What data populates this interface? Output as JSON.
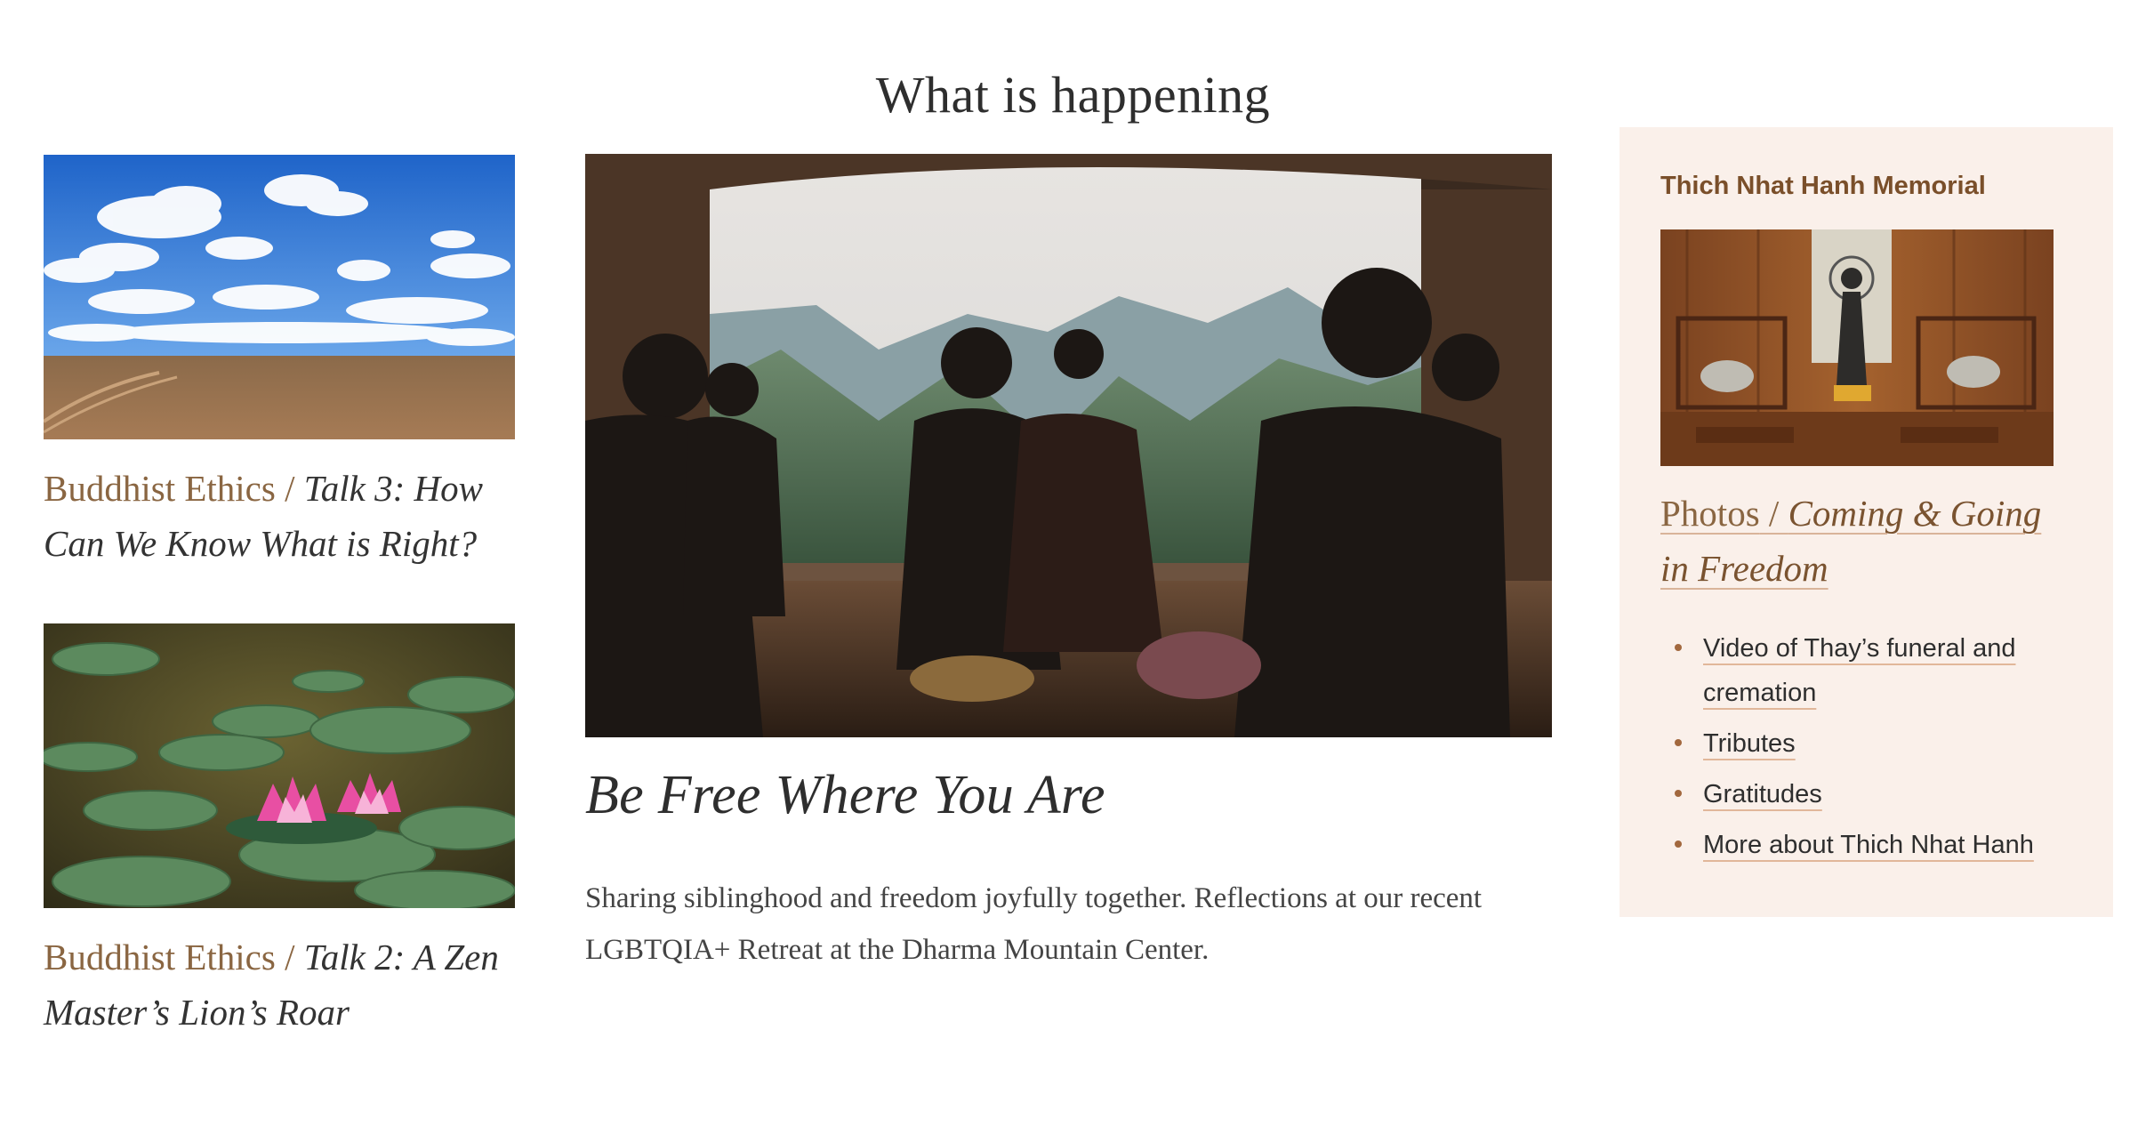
{
  "section": {
    "title": "What is happening"
  },
  "left_cards": [
    {
      "category": "Buddhist Ethics",
      "separator": " / ",
      "title": "Talk 3: How Can We Know What is Right?",
      "image": "sky-field-photo"
    },
    {
      "category": "Buddhist Ethics",
      "separator": " / ",
      "title": "Talk 2: A Zen Master’s Lion’s Roar",
      "image": "lotus-pond-photo"
    }
  ],
  "feature": {
    "title": "Be Free Where You Are",
    "description": "Sharing siblinghood and freedom joyfully together. Reflections at our recent LGBTQIA+ Retreat at the Dharma Mountain Center.",
    "image": "meditation-mountain-photo"
  },
  "sidebar": {
    "heading": "Thich Nhat Hanh Memorial",
    "caption_category": "Photos",
    "caption_separator": " / ",
    "caption_title": "Coming & Going in Freedom",
    "links": [
      "Video of Thay’s funeral and cremation",
      "Tributes",
      "Gratitudes",
      "More about Thich Nhat Hanh"
    ],
    "image": "altar-photo",
    "background": "#faf0ea"
  },
  "colors": {
    "accent_brown": "#8a6642",
    "heading_brown": "#7a4f2a",
    "text": "#2e2e2e"
  }
}
